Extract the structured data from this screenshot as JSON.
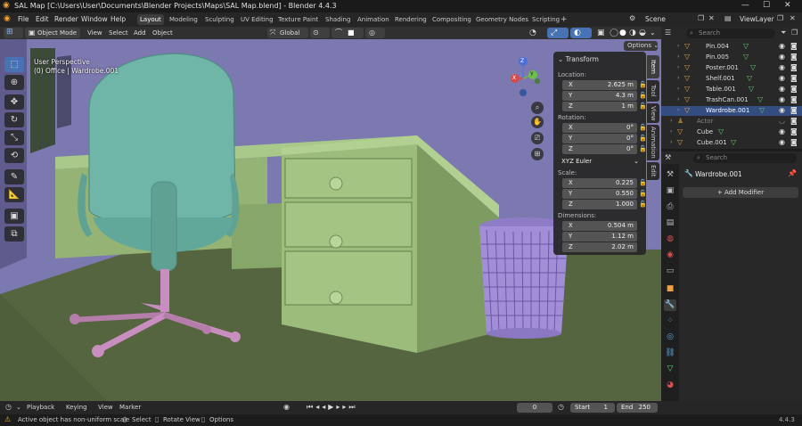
{
  "window": {
    "title": "SAL Map [C:\\Users\\User\\Documents\\Blender Projects\\Maps\\SAL Map.blend] - Blender 4.4.3",
    "minimize": "—",
    "maximize": "☐",
    "close": "✕"
  },
  "menu": [
    "File",
    "Edit",
    "Render",
    "Window",
    "Help"
  ],
  "workspaces": [
    "Layout",
    "Modeling",
    "Sculpting",
    "UV Editing",
    "Texture Paint",
    "Shading",
    "Animation",
    "Rendering",
    "Compositing",
    "Geometry Nodes",
    "Scripting"
  ],
  "active_workspace": "Layout",
  "scene_name": "Scene",
  "view_layer": "ViewLayer",
  "viewport_header": {
    "mode": "Object Mode",
    "menus": [
      "View",
      "Select",
      "Add",
      "Object"
    ],
    "orientation": "Global",
    "options_label": "Options"
  },
  "viewport": {
    "perspective": "User Perspective",
    "context": "(0) Office | Wardrobe.001",
    "gizmo_axes": [
      "Z",
      "Y",
      "X"
    ]
  },
  "npanel": {
    "section": "Transform",
    "location_label": "Location:",
    "location": [
      {
        "axis": "X",
        "value": "2.625 m"
      },
      {
        "axis": "Y",
        "value": "4.3 m"
      },
      {
        "axis": "Z",
        "value": "1 m"
      }
    ],
    "rotation_label": "Rotation:",
    "rotation": [
      {
        "axis": "X",
        "value": "0°"
      },
      {
        "axis": "Y",
        "value": "0°"
      },
      {
        "axis": "Z",
        "value": "0°"
      }
    ],
    "rotation_mode": "XYZ Euler",
    "scale_label": "Scale:",
    "scale": [
      {
        "axis": "X",
        "value": "0.225"
      },
      {
        "axis": "Y",
        "value": "0.550"
      },
      {
        "axis": "Z",
        "value": "1.000"
      }
    ],
    "dimensions_label": "Dimensions:",
    "dimensions": [
      {
        "axis": "X",
        "value": "0.504 m"
      },
      {
        "axis": "Y",
        "value": "1.12 m"
      },
      {
        "axis": "Z",
        "value": "2.02 m"
      }
    ],
    "tabs": [
      "Item",
      "Tool",
      "View",
      "Animation",
      "Edit"
    ]
  },
  "outliner": {
    "search_placeholder": "Search",
    "items": [
      {
        "name": "Pin.004",
        "selected": false,
        "dim": false
      },
      {
        "name": "Pin.005",
        "selected": false,
        "dim": false
      },
      {
        "name": "Poster.001",
        "selected": false,
        "dim": false
      },
      {
        "name": "Shelf.001",
        "selected": false,
        "dim": false
      },
      {
        "name": "Table.001",
        "selected": false,
        "dim": false
      },
      {
        "name": "TrashCan.001",
        "selected": false,
        "dim": false
      },
      {
        "name": "Wardrobe.001",
        "selected": true,
        "dim": false
      },
      {
        "name": "Actor",
        "selected": false,
        "dim": true
      },
      {
        "name": "Cube",
        "selected": false,
        "dim": false
      },
      {
        "name": "Cube.001",
        "selected": false,
        "dim": false
      }
    ]
  },
  "properties": {
    "search_placeholder": "Search",
    "object_name": "Wardrobe.001",
    "add_modifier": "Add Modifier"
  },
  "timeline": {
    "menus": [
      "Playback",
      "Keying",
      "View",
      "Marker"
    ],
    "current_frame": "0",
    "start_label": "Start",
    "start": "1",
    "end_label": "End",
    "end": "250"
  },
  "status": {
    "message": "Active object has non-uniform scale",
    "select": "Select",
    "rotate": "Rotate View",
    "options": "Options",
    "version": "4.4.3"
  },
  "colors": {
    "wall": "#7c78b0",
    "floor": "#556540",
    "desk": "#98ba78",
    "chair": "#6fb5a8",
    "chair_base": "#c88ec0",
    "trash_can": "#a28ed6",
    "selection": "#334d80",
    "accent": "#4772b3"
  }
}
